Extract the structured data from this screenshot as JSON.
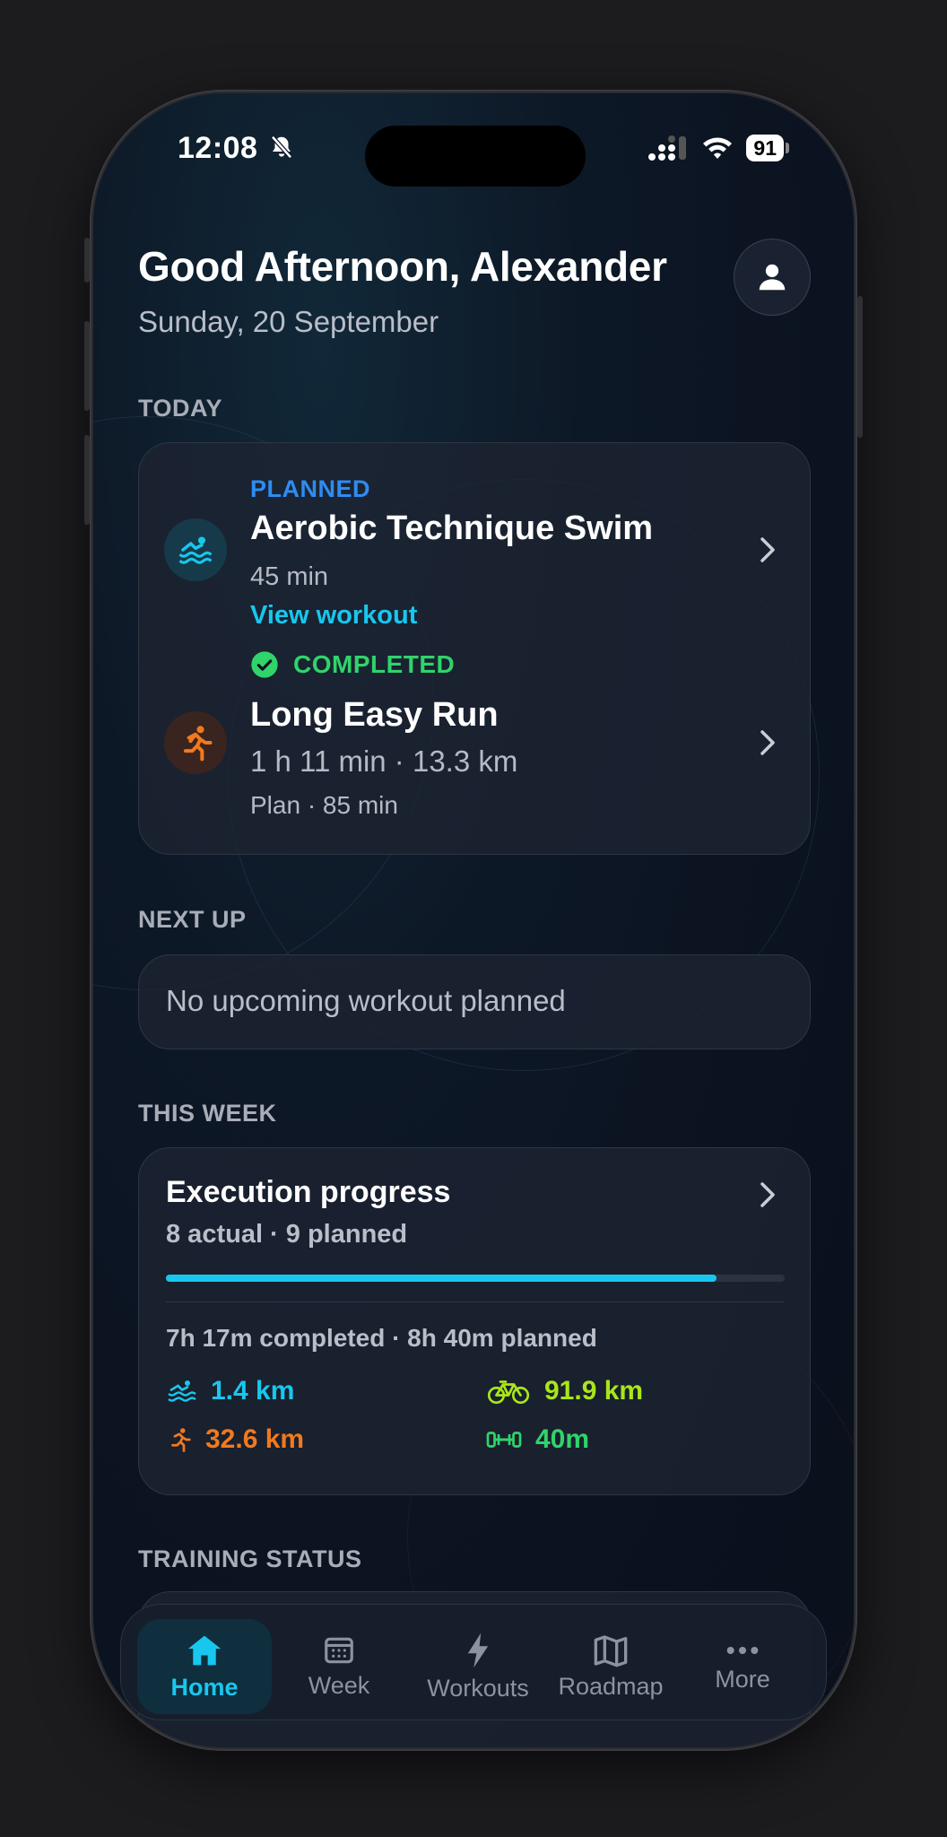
{
  "status_bar": {
    "time": "12:08",
    "battery": "91"
  },
  "header": {
    "greeting": "Good Afternoon, Alexander",
    "date": "Sunday, 20 September"
  },
  "today": {
    "section_label": "TODAY",
    "planned": {
      "status": "PLANNED",
      "title": "Aerobic Technique Swim",
      "duration": "45 min",
      "link": "View workout",
      "icon": "swim-icon"
    },
    "completed": {
      "status": "COMPLETED",
      "title": "Long Easy Run",
      "stats": "1 h 11 min · 13.3 km",
      "plan": "Plan · 85 min",
      "icon": "run-icon"
    }
  },
  "next_up": {
    "section_label": "NEXT UP",
    "message": "No upcoming workout planned"
  },
  "this_week": {
    "section_label": "THIS WEEK",
    "title": "Execution progress",
    "subtitle": "8 actual · 9 planned",
    "progress": 0.89,
    "summary": "7h 17m completed · 8h 40m planned",
    "stats": {
      "swim": "1.4 km",
      "bike": "91.9 km",
      "run": "32.6 km",
      "strength": "40m"
    }
  },
  "training_status": {
    "section_label": "TRAINING STATUS"
  },
  "tabbar": {
    "home": "Home",
    "week": "Week",
    "workouts": "Workouts",
    "roadmap": "Roadmap",
    "more": "More"
  },
  "colors": {
    "accent": "#18c7ee",
    "planned": "#2e8cf0",
    "completed": "#2fd46a",
    "run": "#f07a1e",
    "bike": "#a8e61a",
    "strength": "#2fd46a"
  }
}
